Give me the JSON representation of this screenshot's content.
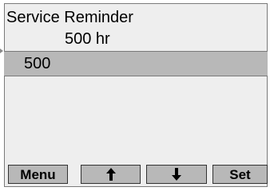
{
  "screen": {
    "title": "Service Reminder",
    "current_value": "500 hr",
    "edit_value": "500"
  },
  "softkeys": {
    "menu_label": "Menu",
    "up_icon": "up-arrow-icon",
    "down_icon": "down-arrow-icon",
    "set_label": "Set"
  },
  "colors": {
    "screen_bg": "#eeeeee",
    "highlight_row": "#b8b8b8",
    "softkey_bg": "#b8b8b8",
    "text": "#000000"
  }
}
